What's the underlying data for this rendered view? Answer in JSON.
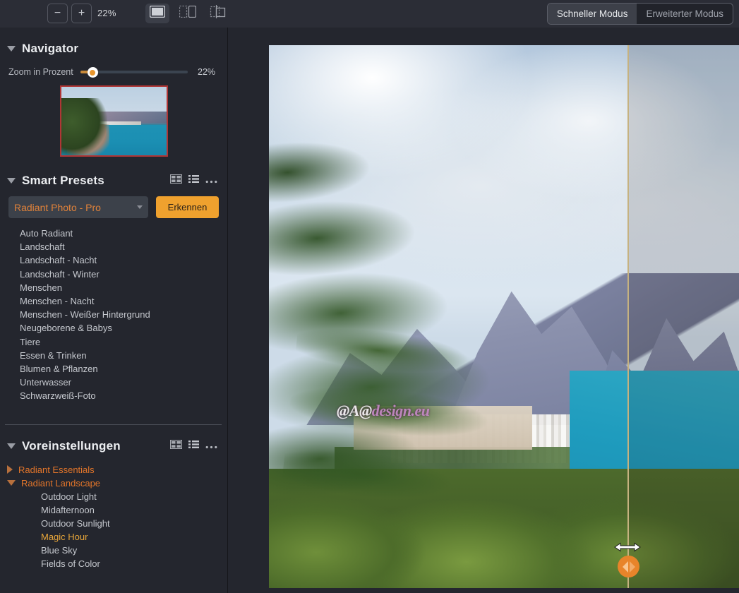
{
  "toolbar": {
    "zoom_out_label": "−",
    "zoom_in_label": "+",
    "zoom_percent": "22%",
    "view_modes": [
      {
        "name": "single-view-icon",
        "active": true
      },
      {
        "name": "split-view-icon",
        "active": false
      },
      {
        "name": "before-after-view-icon",
        "active": false
      }
    ],
    "mode_quick": "Schneller Modus",
    "mode_advanced": "Erweiterter Modus"
  },
  "navigator": {
    "title": "Navigator",
    "zoom_label": "Zoom in Prozent",
    "zoom_value": "22%"
  },
  "smart_presets": {
    "title": "Smart Presets",
    "dropdown_value": "Radiant Photo - Pro",
    "detect_button": "Erkennen",
    "items": [
      "Auto Radiant",
      "Landschaft",
      "Landschaft - Nacht",
      "Landschaft - Winter",
      "Menschen",
      "Menschen - Nacht",
      "Menschen - Weißer Hintergrund",
      "Neugeborene & Babys",
      "Tiere",
      "Essen & Trinken",
      "Blumen & Pflanzen",
      "Unterwasser",
      "Schwarzweiß-Foto"
    ]
  },
  "voreinstellungen": {
    "title": "Voreinstellungen",
    "groups": [
      {
        "label": "Radiant Essentials",
        "expanded": false,
        "children": []
      },
      {
        "label": "Radiant Landscape",
        "expanded": true,
        "children": [
          {
            "label": "Outdoor Light",
            "selected": false
          },
          {
            "label": "Midafternoon",
            "selected": false
          },
          {
            "label": "Outdoor Sunlight",
            "selected": false
          },
          {
            "label": "Magic Hour",
            "selected": true
          },
          {
            "label": "Blue Sky",
            "selected": false
          },
          {
            "label": "Fields of Color",
            "selected": false
          }
        ]
      }
    ]
  },
  "canvas": {
    "watermark_a": "@A@",
    "watermark_b": "design.eu"
  },
  "colors": {
    "accent_orange": "#e2752a",
    "button_orange": "#efa12e",
    "selected_yellow": "#e9a73a",
    "panel_bg": "#24262e",
    "toolbar_bg": "#2b2d36",
    "navigator_border": "#b03535",
    "split_line": "#c6b280"
  }
}
